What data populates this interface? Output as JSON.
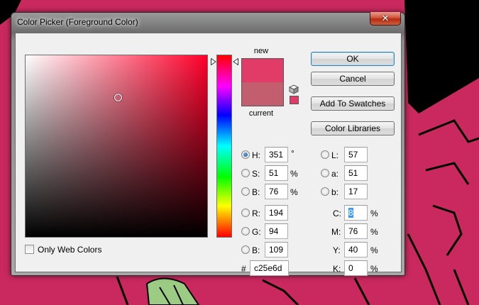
{
  "colors": {
    "current_color": "#c25e6d",
    "new_color": "#e13b68",
    "background_art": "#c9295f"
  },
  "window": {
    "title": "Color Picker (Foreground Color)",
    "close_glyph": "✕"
  },
  "preview": {
    "new_label": "new",
    "current_label": "current"
  },
  "buttons": {
    "ok": "OK",
    "cancel": "Cancel",
    "add_to_swatches": "Add To Swatches",
    "color_libraries": "Color Libraries"
  },
  "hsb": {
    "h_label": "H:",
    "h_value": "351",
    "h_unit": "°",
    "s_label": "S:",
    "s_value": "51",
    "s_unit": "%",
    "b_label": "B:",
    "b_value": "76",
    "b_unit": "%"
  },
  "rgb": {
    "r_label": "R:",
    "r_value": "194",
    "g_label": "G:",
    "g_value": "94",
    "b_label": "B:",
    "b_value": "109"
  },
  "lab": {
    "l_label": "L:",
    "l_value": "57",
    "a_label": "a:",
    "a_value": "51",
    "b_label": "b:",
    "b_value": "17"
  },
  "cmyk": {
    "c_label": "C:",
    "c_value": "8",
    "c_unit": "%",
    "m_label": "M:",
    "m_value": "76",
    "m_unit": "%",
    "y_label": "Y:",
    "y_value": "40",
    "y_unit": "%",
    "k_label": "K:",
    "k_value": "0",
    "k_unit": "%"
  },
  "hex": {
    "label": "#",
    "value": "c25e6d"
  },
  "only_web_colors": {
    "label": "Only Web Colors",
    "checked": false
  },
  "icons": {
    "gamut_warning": "cube-icon",
    "slider_arrows": "triangle-arrow-icon"
  }
}
